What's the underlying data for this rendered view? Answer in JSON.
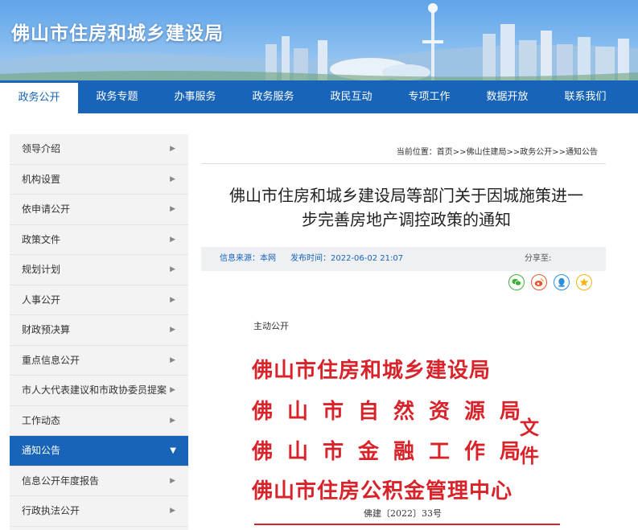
{
  "site": {
    "title": "佛山市住房和城乡建设局"
  },
  "nav": {
    "items": [
      "政务公开",
      "政务专题",
      "办事服务",
      "政务服务",
      "政民互动",
      "专项工作",
      "数据开放",
      "联系我们"
    ],
    "active_index": 0
  },
  "sidebar": {
    "items": [
      "领导介绍",
      "机构设置",
      "依申请公开",
      "政策文件",
      "规划计划",
      "人事公开",
      "财政预决算",
      "重点信息公开",
      "市人大代表建议和市政协委员提案",
      "工作动态",
      "通知公告",
      "信息公开年度报告",
      "行政执法公开"
    ],
    "active_index": 10
  },
  "breadcrumb": {
    "text": "当前位置：首页>>佛山住建局>>政务公开>>通知公告"
  },
  "article": {
    "title_line1": "佛山市住房和城乡建设局等部门关于因城施策进一",
    "title_line2": "步完善房地产调控政策的通知",
    "source": "信息来源：本网",
    "publish_time": "发布时间：2022-06-02 21:07",
    "share_label": "分享至:",
    "public_tag": "主动公开"
  },
  "share_icons": [
    "wechat-icon",
    "weibo-icon",
    "qq-icon",
    "qzone-icon"
  ],
  "document": {
    "lines": [
      "佛山市住房和城乡建设局",
      "佛山市自然资源局",
      "佛山市金融工作局",
      "佛山市住房公积金管理中心"
    ],
    "suffix": "文件",
    "number": "佛建〔2022〕33号"
  },
  "colors": {
    "primary": "#1764b8",
    "doc_red": "#d8232a"
  }
}
